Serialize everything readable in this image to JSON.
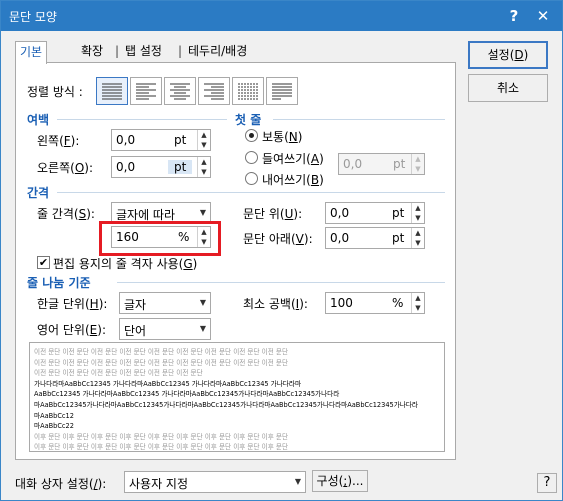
{
  "window": {
    "title": "문단 모양",
    "help_label": "?",
    "close_label": "✕"
  },
  "tabs": [
    {
      "label": "기본"
    },
    {
      "label": "확장"
    },
    {
      "label": "탭 설정"
    },
    {
      "label": "테두리/배경"
    }
  ],
  "tab_separator": "|",
  "alignment": {
    "label": "정렬 방식 :",
    "options": [
      "양쪽 정렬",
      "왼쪽 정렬",
      "가운데 정렬",
      "오른쪽 정렬",
      "배분 정렬",
      "나눔 정렬"
    ],
    "selected": 0
  },
  "margin": {
    "title": "여백",
    "left": {
      "label_pre": "왼쪽(",
      "key": "F",
      "label_post": "):",
      "value": "0,0",
      "unit": "pt"
    },
    "right": {
      "label_pre": "오른쪽(",
      "key": "O",
      "label_post": "):",
      "value": "0,0",
      "unit": "pt"
    }
  },
  "first_line": {
    "title": "첫 줄",
    "normal": {
      "label_pre": "보통(",
      "key": "N",
      "label_post": ")",
      "checked": true
    },
    "indent": {
      "label_pre": "들여쓰기(",
      "key": "A",
      "label_post": ")",
      "checked": false
    },
    "outdent": {
      "label_pre": "내어쓰기(",
      "key": "B",
      "label_post": ")",
      "checked": false
    },
    "value": "0,0",
    "unit": "pt"
  },
  "spacing": {
    "title": "간격",
    "line_spacing": {
      "label_pre": "줄 간격(",
      "key": "S",
      "label_post": "):",
      "type_value": "글자에 따라",
      "value": "160",
      "unit": "%"
    },
    "before": {
      "label_pre": "문단 위(",
      "key": "U",
      "label_post": "):",
      "value": "0,0",
      "unit": "pt"
    },
    "after": {
      "label_pre": "문단 아래(",
      "key": "V",
      "label_post": "):",
      "value": "0,0",
      "unit": "pt"
    },
    "grid": {
      "label_pre": "편집 용지의 줄 격자 사용(",
      "key": "G",
      "label_post": ")",
      "checked": true
    }
  },
  "line_break": {
    "title": "줄 나눔 기준",
    "korean": {
      "label_pre": "한글 단위(",
      "key": "H",
      "label_post": "):",
      "value": "글자"
    },
    "english": {
      "label_pre": "영어 단위(",
      "key": "E",
      "label_post": "):",
      "value": "단어"
    },
    "min_space": {
      "label_pre": "최소 공백(",
      "key": "I",
      "label_post": "):",
      "value": "100",
      "unit": "%"
    }
  },
  "preview": {
    "gray_lines": [
      "이전 문단 이전 문단 이전 문단 이전 문단 이전 문단 이전 문단 이전 문단 이전 문단 이전 문단",
      "이전 문단 이전 문단 이전 문단 이전 문단 이전 문단 이전 문단 이전 문단 이전 문단 이전 문단",
      "이전 문단 이전 문단 이전 문단 이전 문단 이전 문단 이전 문단"
    ],
    "sample_lines": [
      "가나다라마AaBbCc12345        가나다라마AaBbCc12345        가나다라마AaBbCc12345        가나다라마",
      "AaBbCc12345   가나다라마AaBbCc12345   가나다라마AaBbCc12345가나다라마AaBbCc12345가나다라",
      "마AaBbCc12345가나다라마AaBbCc12345가나다라마AaBbCc12345가나다라마AaBbCc12345가나다라마AaBbCc12345가나다라",
      "마AaBbCc12",
      "마AaBbCc22"
    ],
    "after_lines": [
      "이후 문단 이후 문단 이후 문단 이후 문단 이후 문단 이후 문단 이후 문단 이후 문단 이후 문단",
      "이후 문단 이후 문단 이후 문단 이후 문단 이후 문단 이후 문단 이후 문단 이후 문단 이후 문단"
    ]
  },
  "buttons": {
    "ok": {
      "label_pre": "설정(",
      "key": "D",
      "label_post": ")"
    },
    "cancel": "취소",
    "config": {
      "label_pre": "구성(",
      "key": ";",
      "label_post": ")..."
    }
  },
  "dialog_setting": {
    "label_pre": "대화 상자 설정(",
    "key": "/",
    "label_post": "):",
    "value": "사용자 지정"
  },
  "bottom_help": "?"
}
